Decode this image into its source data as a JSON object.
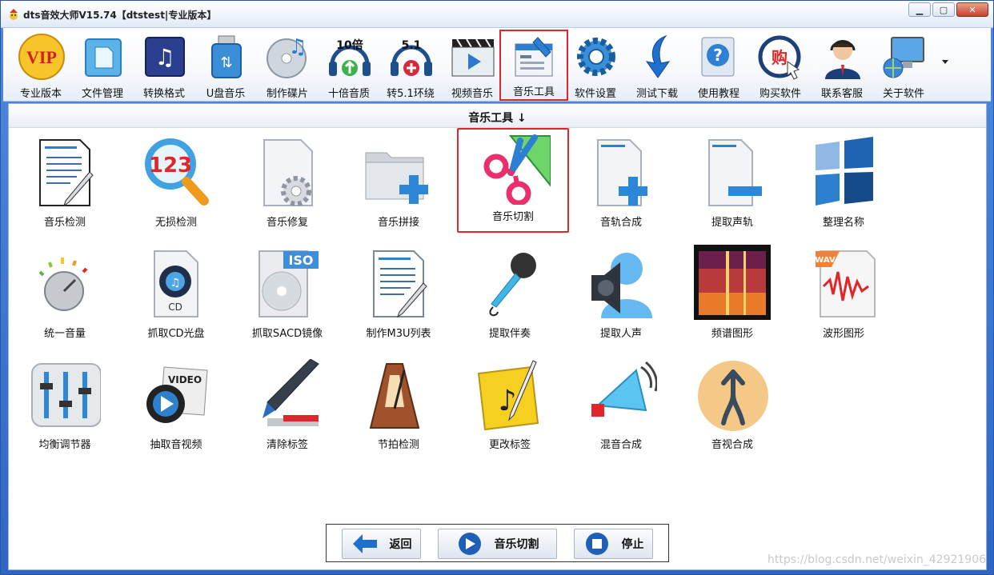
{
  "window": {
    "title": "dts音效大师V15.74【dtstest|专业版本】"
  },
  "toolbar": {
    "items": [
      {
        "label": "专业版本",
        "icon": "vip-icon"
      },
      {
        "label": "文件管理",
        "icon": "file-manager-icon"
      },
      {
        "label": "转换格式",
        "icon": "convert-format-icon"
      },
      {
        "label": "U盘音乐",
        "icon": "usb-drive-icon"
      },
      {
        "label": "制作碟片",
        "icon": "disc-icon"
      },
      {
        "label": "十倍音质",
        "icon": "ten-times-quality-icon",
        "badge": "10倍"
      },
      {
        "label": "转5.1环绕",
        "icon": "surround-icon",
        "badge": "5.1"
      },
      {
        "label": "视频音乐",
        "icon": "video-music-icon"
      },
      {
        "label": "音乐工具",
        "icon": "music-tools-icon",
        "selected": true
      },
      {
        "label": "软件设置",
        "icon": "gear-icon"
      },
      {
        "label": "测试下载",
        "icon": "download-arrow-icon"
      },
      {
        "label": "使用教程",
        "icon": "help-icon"
      },
      {
        "label": "购买软件",
        "icon": "buy-icon",
        "badge": "购"
      },
      {
        "label": "联系客服",
        "icon": "customer-service-icon"
      },
      {
        "label": "关于软件",
        "icon": "about-computer-icon"
      }
    ]
  },
  "section": {
    "title": "音乐工具 ↓"
  },
  "tools": [
    {
      "label": "音乐检测",
      "icon": "music-detect-icon"
    },
    {
      "label": "无损检测",
      "icon": "lossless-detect-icon"
    },
    {
      "label": "音乐修复",
      "icon": "music-repair-icon"
    },
    {
      "label": "音乐拼接",
      "icon": "music-join-icon"
    },
    {
      "label": "音乐切割",
      "icon": "scissors-icon",
      "selected": true
    },
    {
      "label": "音轨合成",
      "icon": "track-merge-icon"
    },
    {
      "label": "提取声轨",
      "icon": "extract-track-icon"
    },
    {
      "label": "整理名称",
      "icon": "organize-names-icon"
    },
    {
      "label": "统一音量",
      "icon": "volume-knob-icon"
    },
    {
      "label": "抓取CD光盘",
      "icon": "cd-rip-icon"
    },
    {
      "label": "抓取SACD镜像",
      "icon": "sacd-iso-icon",
      "badge": "ISO"
    },
    {
      "label": "制作M3U列表",
      "icon": "m3u-list-icon"
    },
    {
      "label": "提取伴奏",
      "icon": "microphone-icon"
    },
    {
      "label": "提取人声",
      "icon": "speaker-voice-icon"
    },
    {
      "label": "频谱图形",
      "icon": "spectrum-icon"
    },
    {
      "label": "波形图形",
      "icon": "waveform-icon",
      "badge": "WAV"
    },
    {
      "label": "均衡调节器",
      "icon": "equalizer-icon"
    },
    {
      "label": "抽取音视频",
      "icon": "video-extract-icon",
      "badge": "VIDEO"
    },
    {
      "label": "清除标签",
      "icon": "marker-icon"
    },
    {
      "label": "节拍检测",
      "icon": "metronome-icon"
    },
    {
      "label": "更改标签",
      "icon": "edit-tag-icon"
    },
    {
      "label": "混音合成",
      "icon": "megaphone-icon"
    },
    {
      "label": "音视合成",
      "icon": "merge-arrow-icon"
    }
  ],
  "buttons": {
    "back": "返回",
    "action": "音乐切割",
    "stop": "停止"
  },
  "watermark": "https://blog.csdn.net/weixin_42921906"
}
